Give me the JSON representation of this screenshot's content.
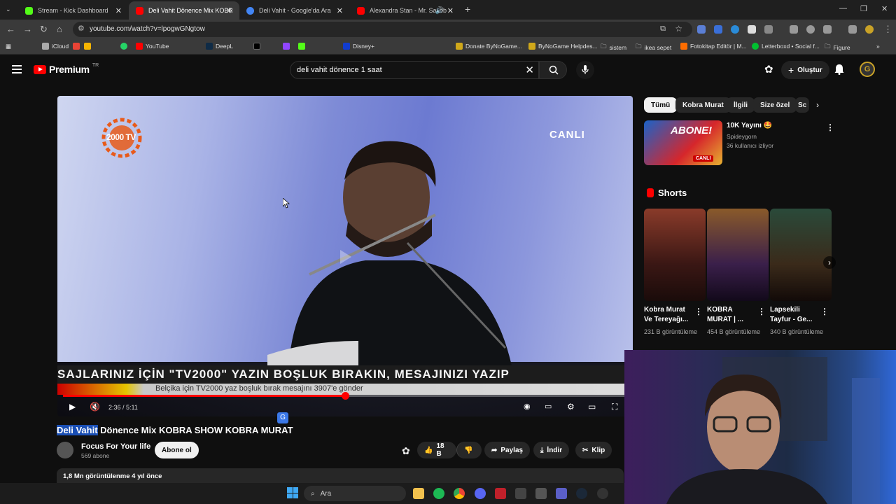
{
  "browser": {
    "tabs": [
      {
        "title": "Stream - Kick Dashboard",
        "favicon_color": "#53fc18"
      },
      {
        "title": "Deli Vahit Dönence Mix KOBRA",
        "favicon_color": "#ff0000"
      },
      {
        "title": "Deli Vahit - Google'da Ara",
        "favicon_color": "#4285f4"
      },
      {
        "title": "Alexandra Stan - Mr. Saxob",
        "favicon_color": "#ff0000"
      }
    ],
    "url": "youtube.com/watch?v=lpogwGNgtow",
    "bookmarks": [
      "iCloud",
      "YouTube",
      "DeepL",
      "Disney+",
      "Donate ByNoGame...",
      "ByNoGame Helpdes...",
      "sistem",
      "ikea sepet",
      "Fotokitap Editör | M...",
      "Letterboxd • Social f...",
      "Figure"
    ]
  },
  "youtube": {
    "logo_text": "Premium",
    "logo_country": "TR",
    "search_query": "deli vahit dönence 1 saat",
    "create_label": "Oluştur"
  },
  "video": {
    "title_highlight": "Deli Vahit",
    "title_rest": " Dönence Mix KOBRA SHOW KOBRA MURAT",
    "time": "2:36 / 5:11",
    "progress": 0.5,
    "overlay_live": "CANLI",
    "overlay_ticker": "SAJLARINIZ İÇİN  \"TV2000\" YAZIN BOŞLUK BIRAKIN, MESAJINIZI YAZIP",
    "overlay_ticker2": "Belçika için TV2000 yaz boşluk bırak mesajını 3907'e gönder",
    "channel_logo_text": "2000 TV"
  },
  "channel": {
    "name": "Focus For Your life",
    "subs": "569 abone",
    "subscribe_label": "Abone ol"
  },
  "actions": {
    "likes": "18 B",
    "share": "Paylaş",
    "download": "İndir",
    "clip": "Klip"
  },
  "description": {
    "views_date": "1,8 Mn görüntülenme  4 yıl önce"
  },
  "sidebar": {
    "chips": [
      "Tümü",
      "Kobra Murat",
      "İlgili",
      "Size özel",
      "Sc"
    ],
    "live": {
      "title": "10K Yayını 🤩",
      "channel": "Spideygorn",
      "watching": "36 kullanıcı izliyor",
      "thumb_text": "ABONE!",
      "thumb_badge": "CANLI"
    },
    "shorts_heading": "Shorts",
    "shorts": [
      {
        "title": "Kobra Murat Ve Tereyağı...",
        "views": "231 B görüntüleme"
      },
      {
        "title": "KOBRA MURAT | ...",
        "views": "454 B görüntüleme"
      },
      {
        "title": "Lapsekili Tayfur - Ge...",
        "views": "340 B görüntüleme"
      }
    ]
  },
  "taskbar": {
    "search_label": "Ara"
  }
}
